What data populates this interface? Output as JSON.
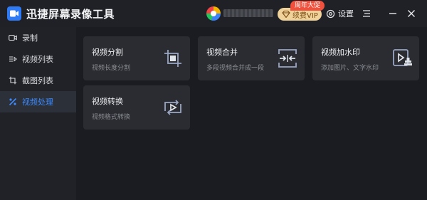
{
  "app": {
    "title": "迅捷屏幕录像工具"
  },
  "header": {
    "vip_label": "续费VIP",
    "promo_badge": "周年大促",
    "settings_label": "设置"
  },
  "sidebar": {
    "items": [
      {
        "label": "录制",
        "icon": "video-camera-icon",
        "active": false
      },
      {
        "label": "视频列表",
        "icon": "video-list-icon",
        "active": false
      },
      {
        "label": "截图列表",
        "icon": "screenshot-list-icon",
        "active": false
      },
      {
        "label": "视频处理",
        "icon": "video-process-icon",
        "active": true
      }
    ]
  },
  "cards": [
    {
      "title": "视频分割",
      "subtitle": "视频长度分割",
      "icon": "crop-icon"
    },
    {
      "title": "视频合并",
      "subtitle": "多段视频合并成一段",
      "icon": "merge-icon"
    },
    {
      "title": "视频加水印",
      "subtitle": "添加图片、文字水印",
      "icon": "watermark-icon"
    },
    {
      "title": "视频转换",
      "subtitle": "视频格式转换",
      "icon": "convert-icon"
    }
  ],
  "colors": {
    "accent": "#3d8bff",
    "background": "#1a1c21",
    "card": "#2a2c31",
    "icon_stroke": "#9aa6c4",
    "vip_gold": "#efd39a",
    "promo_red": "#f0503c"
  }
}
